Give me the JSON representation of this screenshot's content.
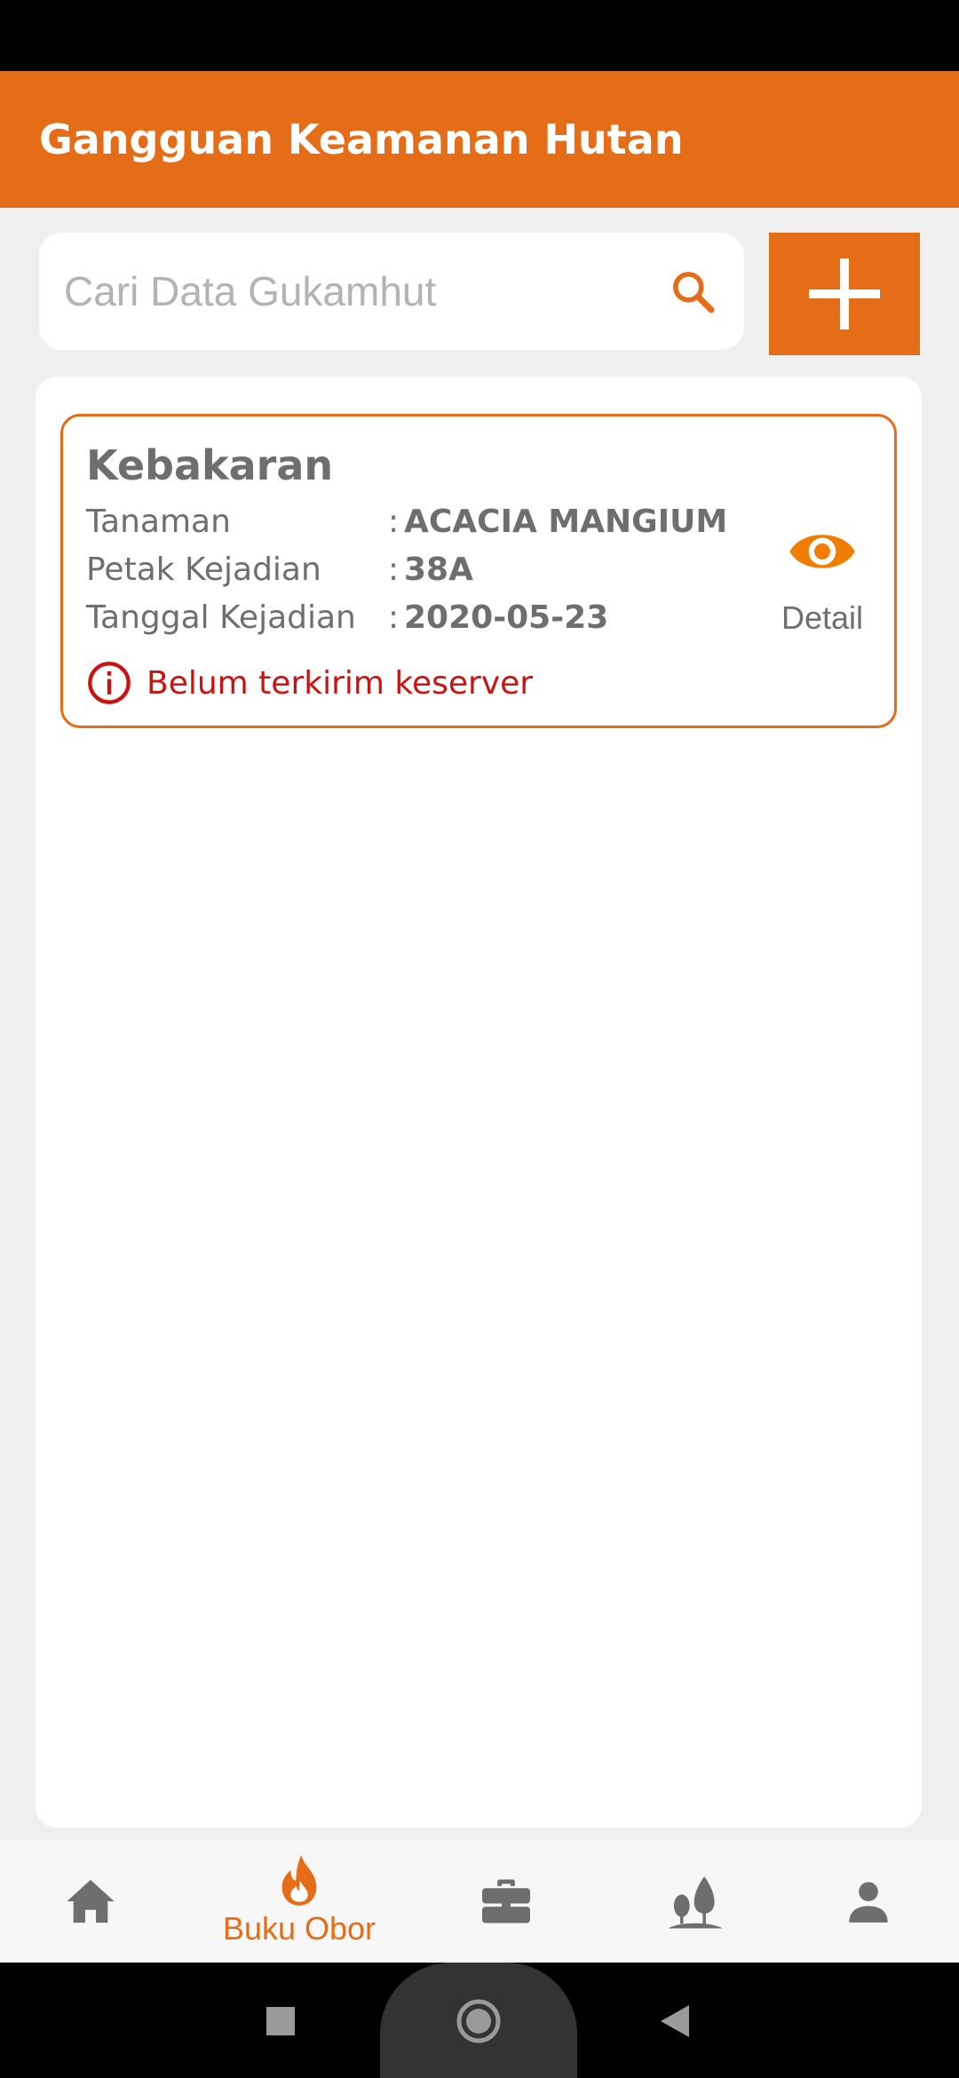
{
  "app_bar": {
    "title": "Gangguan Keamanan Hutan"
  },
  "search": {
    "placeholder": "Cari Data Gukamhut",
    "value": ""
  },
  "colors": {
    "accent": "#e56d17",
    "warning": "#cc1111",
    "text": "#6e6e6e"
  },
  "card": {
    "title": "Kebakaran",
    "rows": [
      {
        "label": "Tanaman",
        "value": "ACACIA MANGIUM"
      },
      {
        "label": "Petak Kejadian",
        "value": "38A"
      },
      {
        "label": "Tanggal Kejadian",
        "value": "2020-05-23"
      }
    ],
    "status": "Belum terkirim keserver",
    "detail_label": "Detail"
  },
  "bottom_nav": {
    "items": [
      {
        "icon": "home-icon",
        "label": ""
      },
      {
        "icon": "fire-icon",
        "label": "Buku Obor",
        "active": true
      },
      {
        "icon": "briefcase-icon",
        "label": ""
      },
      {
        "icon": "trees-icon",
        "label": ""
      },
      {
        "icon": "person-icon",
        "label": ""
      }
    ]
  }
}
